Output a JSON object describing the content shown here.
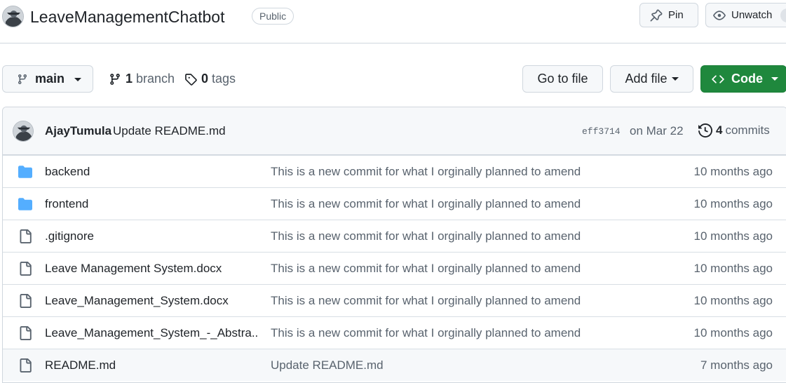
{
  "repo": {
    "name": "LeaveManagementChatbot",
    "visibility": "Public",
    "pin_label": "Pin",
    "watch_label": "Unwatch"
  },
  "toolbar": {
    "branch_name": "main",
    "branch_count": "1",
    "branch_word": "branch",
    "tag_count": "0",
    "tag_word": "tags",
    "goto_label": "Go to file",
    "add_label": "Add file",
    "code_label": "Code"
  },
  "latest_commit": {
    "author": "AjayTumula",
    "message": "Update README.md",
    "sha": "eff3714",
    "date": "on Mar 22",
    "count": "4",
    "count_word": "commits"
  },
  "files": [
    {
      "type": "folder",
      "name": "backend",
      "commit": "This is a new commit for what I orginally planned to amend",
      "age": "10 months ago"
    },
    {
      "type": "folder",
      "name": "frontend",
      "commit": "This is a new commit for what I orginally planned to amend",
      "age": "10 months ago"
    },
    {
      "type": "file",
      "name": ".gitignore",
      "commit": "This is a new commit for what I orginally planned to amend",
      "age": "10 months ago"
    },
    {
      "type": "file",
      "name": "Leave Management System.docx",
      "commit": "This is a new commit for what I orginally planned to amend",
      "age": "10 months ago"
    },
    {
      "type": "file",
      "name": "Leave_Management_System.docx",
      "commit": "This is a new commit for what I orginally planned to amend",
      "age": "10 months ago"
    },
    {
      "type": "file",
      "name": "Leave_Management_System_-_Abstra...",
      "commit": "This is a new commit for what I orginally planned to amend",
      "age": "10 months ago"
    },
    {
      "type": "file",
      "name": "README.md",
      "commit": "Update README.md",
      "age": "7 months ago"
    }
  ],
  "colors": {
    "folder": "#54aeff",
    "primary": "#1f883d",
    "muted": "#59636e",
    "border": "#d0d7de"
  },
  "icons": {
    "folder": "folder-icon",
    "file": "file-icon",
    "branch": "git-branch-icon",
    "tag": "tag-icon",
    "history": "history-icon",
    "pin": "pin-icon",
    "watch": "eye-icon",
    "code": "code-icon"
  }
}
